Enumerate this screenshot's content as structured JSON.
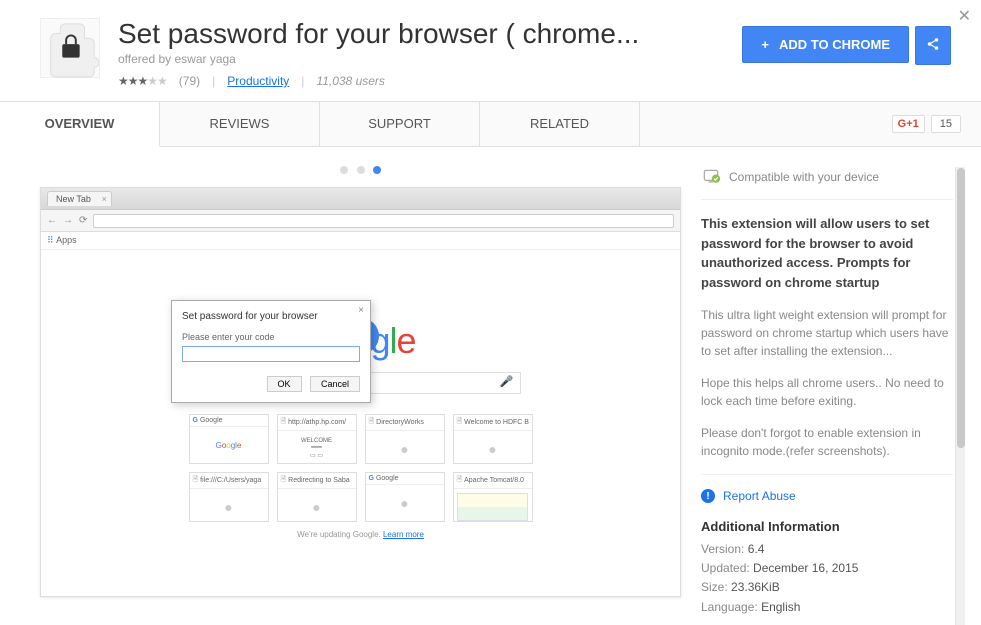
{
  "header": {
    "title": "Set password for your browser ( chrome...",
    "offered_by_label": "offered by ",
    "offered_by": "eswar yaga",
    "ratings_count": "(79)",
    "category": "Productivity",
    "users": "11,038 users",
    "add_button": "ADD TO CHROME"
  },
  "tabs": {
    "overview": "OVERVIEW",
    "reviews": "REVIEWS",
    "support": "SUPPORT",
    "related": "RELATED",
    "gplus_label": "G+1",
    "gplus_count": "15"
  },
  "screenshot": {
    "tab_label": "New Tab",
    "apps_label": "Apps",
    "dialog_title": "Set password for your browser",
    "dialog_prompt": "Please enter your code",
    "ok": "OK",
    "cancel": "Cancel",
    "search_placeholder": "",
    "thumbs": [
      {
        "t": "Google",
        "g": true,
        "body": "google"
      },
      {
        "t": "http://athp.hp.com/",
        "body": "doc"
      },
      {
        "t": "DirectoryWorks",
        "body": "dot"
      },
      {
        "t": "Welcome to HDFC B",
        "body": "dot"
      },
      {
        "t": "file:///C:/Users/yaga",
        "body": "dot"
      },
      {
        "t": "Redirecting to Saba",
        "body": "dot"
      },
      {
        "t": "Google",
        "g": true,
        "body": "dot"
      },
      {
        "t": "Apache Tomcat/8.0",
        "body": "tomcat"
      }
    ],
    "update_text": "We're updating Google. ",
    "learn_more": "Learn more"
  },
  "sidebar": {
    "compatible": "Compatible with your device",
    "summary": "This extension will allow users to set password for the browser to avoid unauthorized access. Prompts for password on chrome startup",
    "p1": "This ultra light weight extension will prompt for password on chrome startup which users have to set after installing the extension...",
    "p2": "Hope this helps all chrome users.. No need to lock each time before exiting.",
    "p3": "Please don't forgot to enable extension in incognito mode.(refer screenshots).",
    "report": "Report Abuse",
    "info_title": "Additional Information",
    "version_label": "Version: ",
    "version": "6.4",
    "updated_label": "Updated: ",
    "updated": "December 16, 2015",
    "size_label": "Size: ",
    "size": "23.36KiB",
    "lang_label": "Language: ",
    "lang": "English"
  }
}
